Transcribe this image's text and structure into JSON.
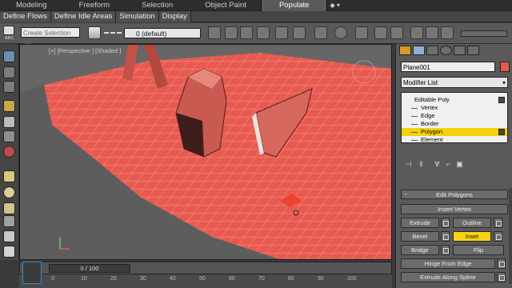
{
  "ribbon": {
    "tabs": [
      "Modeling",
      "Freeform",
      "Selection",
      "Object Paint",
      "Populate"
    ],
    "active_tab": "Populate",
    "extra": "◆ ▾",
    "buttons": [
      "Define Flows",
      "Define Idle Areas",
      "Simulation",
      "Display"
    ]
  },
  "toolbar": {
    "selection_set_placeholder": "Create Selection Se",
    "layer_value": "0 (default)",
    "abc_label": "ABC"
  },
  "viewport": {
    "label": "[+] [Perspective ] [Shaded ]",
    "accent": "#e85a50"
  },
  "time_slider": {
    "value": "0 / 100"
  },
  "timeline": {
    "ticks": [
      "0",
      "10",
      "20",
      "30",
      "40",
      "50",
      "60",
      "70",
      "80",
      "90",
      "100"
    ]
  },
  "command_panel": {
    "object_name": "Plane001",
    "object_color": "#e85a50",
    "modifier_list": "Modifier List",
    "stack": {
      "root": "Editable Poly",
      "items": [
        "Vertex",
        "Edge",
        "Border",
        "Polygon",
        "Element"
      ],
      "selected": "Polygon"
    },
    "rollout_title": "Edit Polygons",
    "rollout_toggle": "−",
    "buttons": {
      "insert_vertex": "Insert Vertex",
      "extrude": "Extrude",
      "outline": "Outline",
      "bevel": "Bevel",
      "inset": "Inset",
      "bridge": "Bridge",
      "flip": "Flip",
      "hinge": "Hinge From Edge",
      "extrude_spline": "Extrude Along Spline"
    },
    "active_button": "Inset",
    "active_color": "#f6d413"
  }
}
